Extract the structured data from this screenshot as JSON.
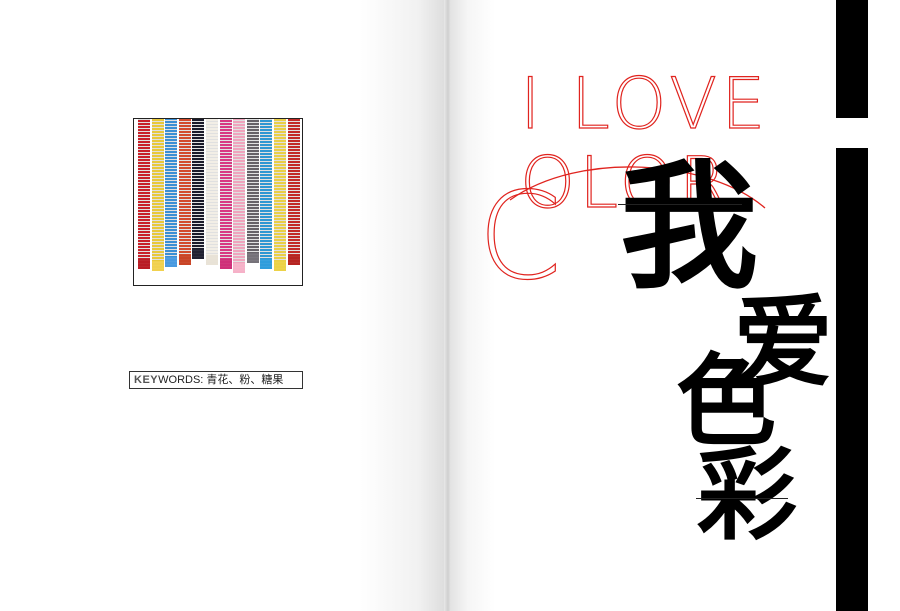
{
  "keywords": {
    "label": "KEY",
    "label_rest": "WORDS:",
    "value": "青花、粉、糖果"
  },
  "title": {
    "line1": "I LOVE",
    "line2": "OLOR",
    "initial": "C"
  },
  "chinese": {
    "char1": "我",
    "char2": "爱",
    "char3": "色",
    "char4": "彩"
  },
  "colors": {
    "accent": "#e0241f",
    "black": "#000000"
  },
  "photo": {
    "subject": "knitted ties",
    "ties": [
      "#c8202a",
      "#e8c93a",
      "#3b8fd4",
      "#d24b2c",
      "#1a1a2a",
      "#f2eee6",
      "#d83a82",
      "#f0a4bd",
      "#666268",
      "#2e97d2",
      "#e9cf47",
      "#c22a27"
    ]
  }
}
